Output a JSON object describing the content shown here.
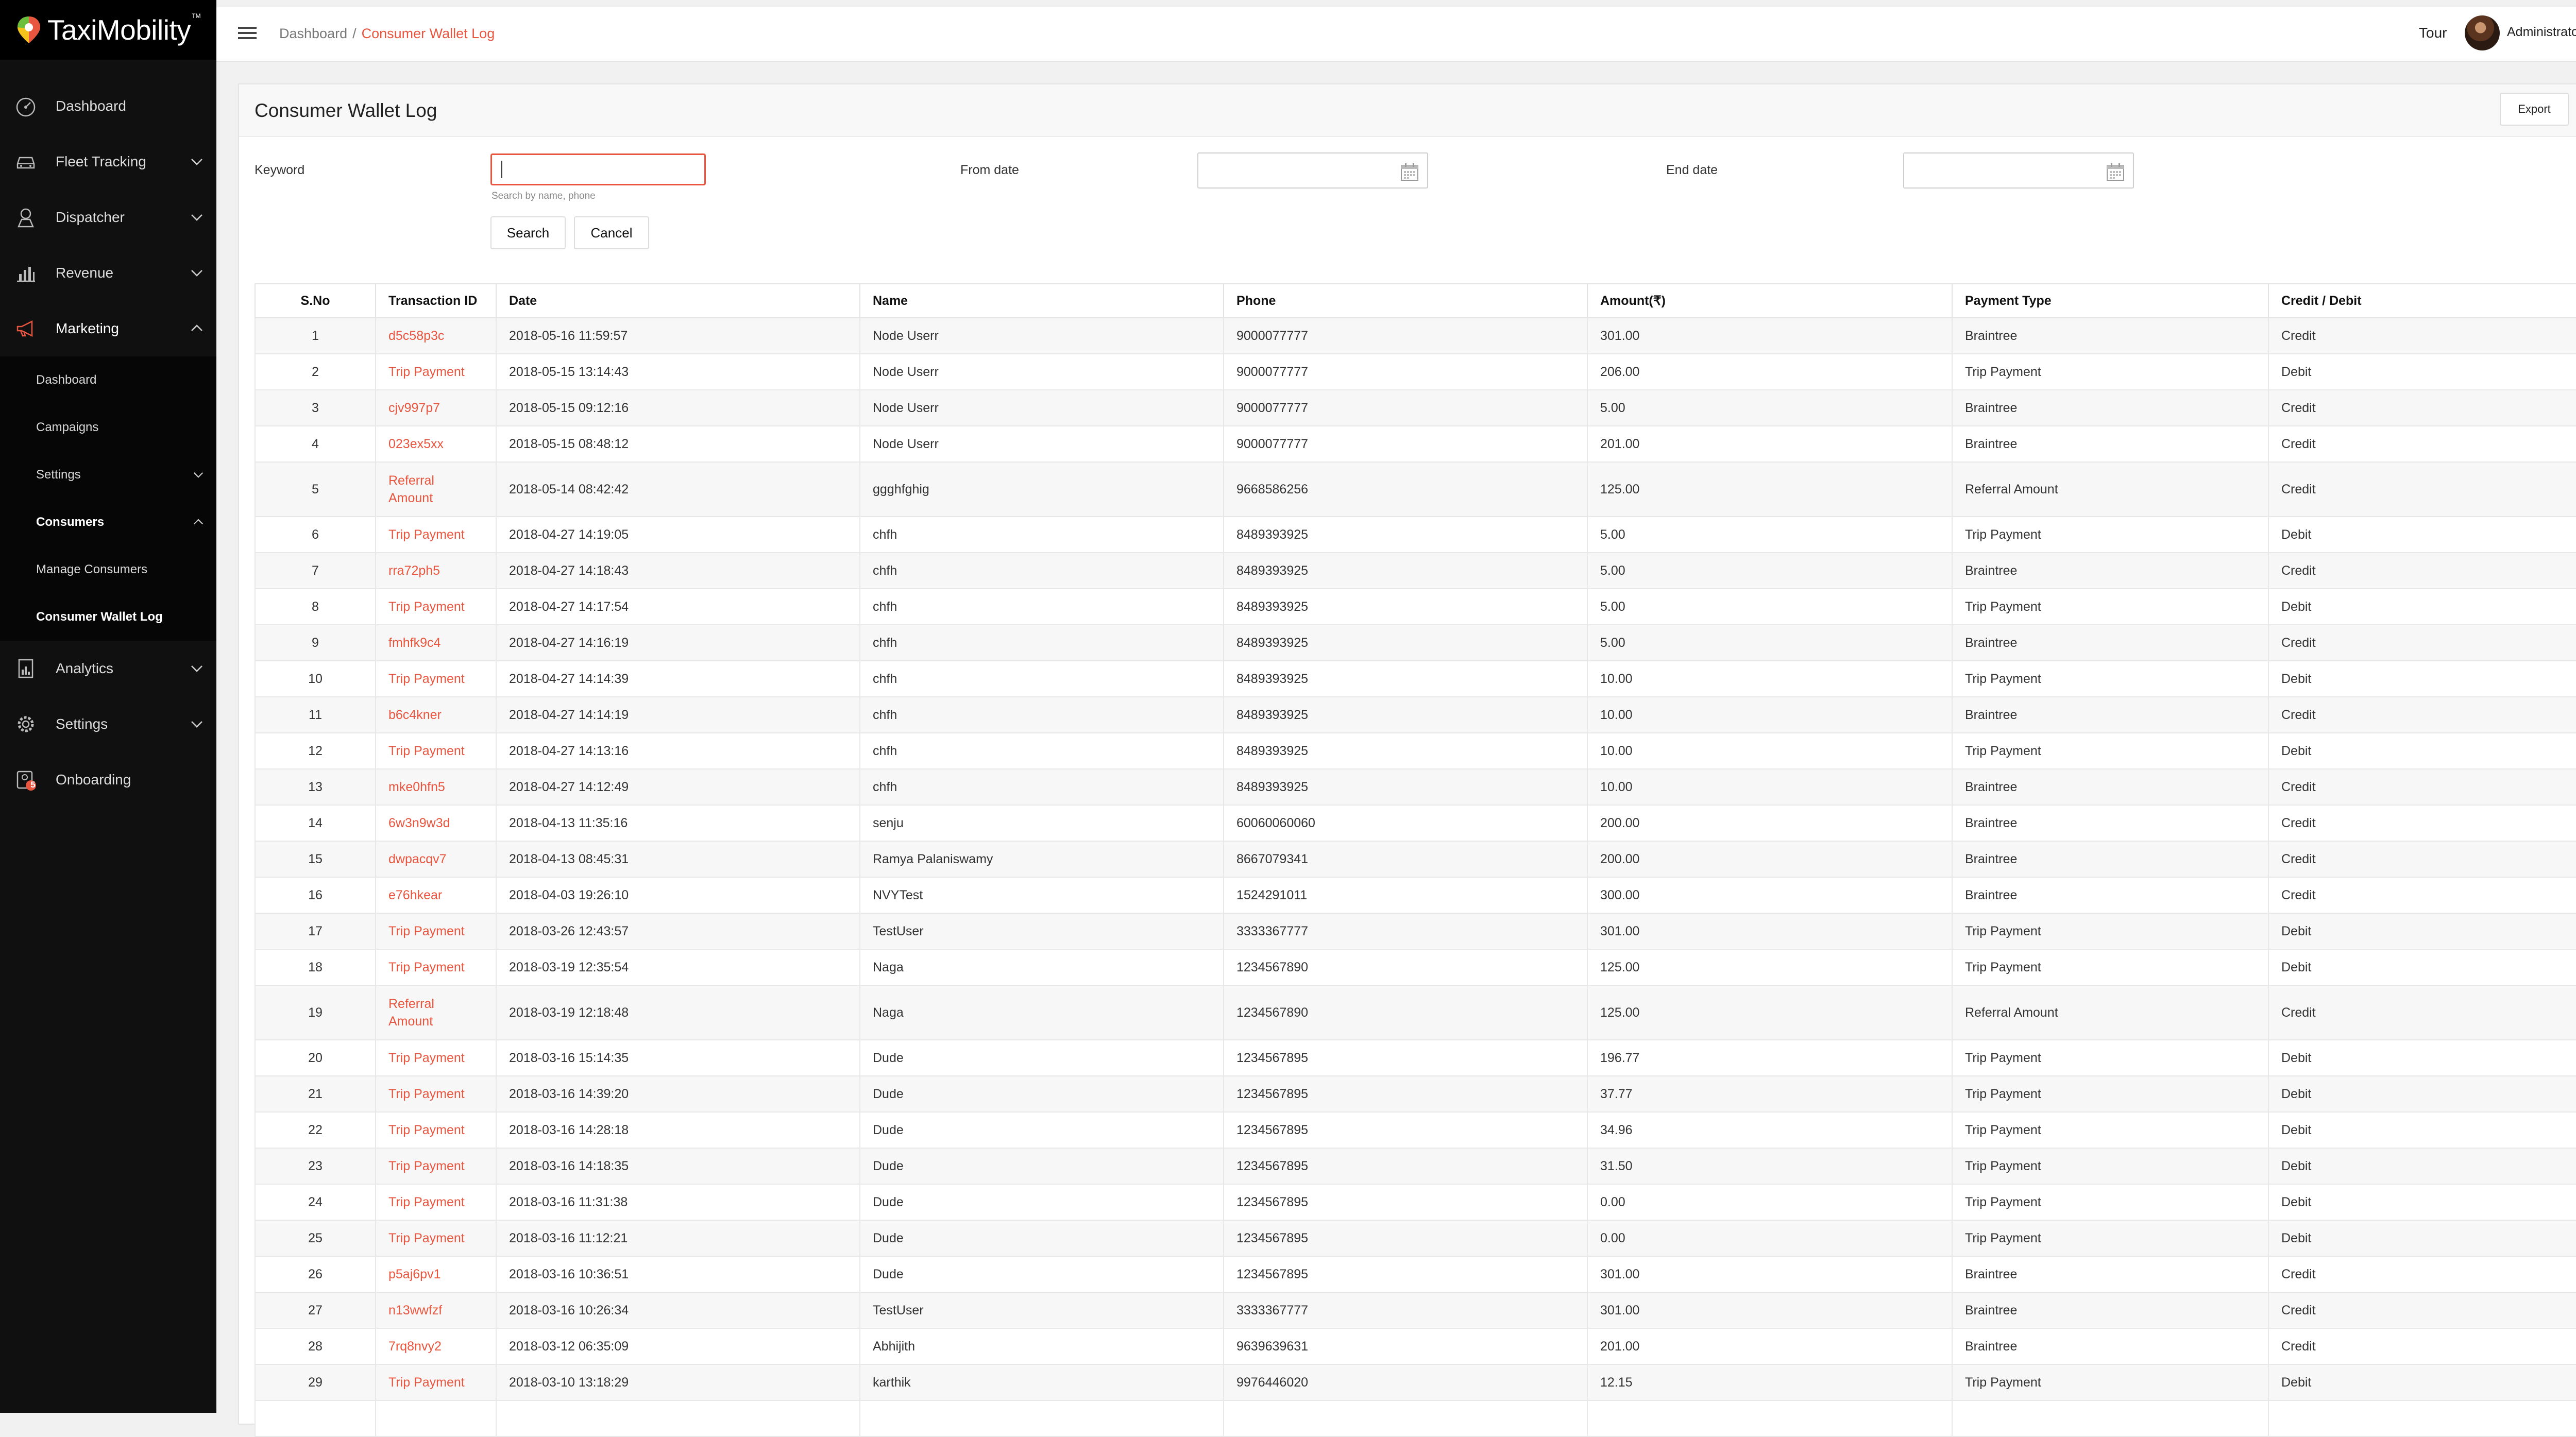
{
  "app": {
    "logo_text": "TaxiMobility",
    "logo_tm": "TM",
    "accent": "#e8563f"
  },
  "sidebar": {
    "items": [
      {
        "label": "Dashboard",
        "icon": "speedometer-icon",
        "has_chevron": false
      },
      {
        "label": "Fleet Tracking",
        "icon": "car-icon",
        "has_chevron": true
      },
      {
        "label": "Dispatcher",
        "icon": "dispatcher-pin-icon",
        "has_chevron": true
      },
      {
        "label": "Revenue",
        "icon": "bar-chart-icon",
        "has_chevron": true
      },
      {
        "label": "Marketing",
        "icon": "megaphone-icon",
        "has_chevron": true,
        "expanded": true
      }
    ],
    "marketing_sub": [
      {
        "label": "Dashboard"
      },
      {
        "label": "Campaigns"
      },
      {
        "label": "Settings",
        "has_chevron": true
      },
      {
        "label": "Consumers",
        "bold": true,
        "expanded": true
      },
      {
        "label": "Manage Consumers"
      },
      {
        "label": "Consumer Wallet Log",
        "active": true
      }
    ],
    "bottom_items": [
      {
        "label": "Analytics",
        "icon": "analytics-doc-icon",
        "has_chevron": true
      },
      {
        "label": "Settings",
        "icon": "gear-icon",
        "has_chevron": true
      },
      {
        "label": "Onboarding",
        "icon": "onboarding-icon",
        "badge": "5"
      }
    ]
  },
  "topbar": {
    "breadcrumb": {
      "root": "Dashboard",
      "separator": "/",
      "current": "Consumer Wallet Log"
    },
    "tour": "Tour",
    "user": "Administrator"
  },
  "page": {
    "title": "Consumer Wallet Log",
    "export_label": "Export",
    "filters": {
      "keyword_label": "Keyword",
      "keyword_value": "",
      "keyword_help": "Search by name, phone",
      "from_label": "From date",
      "end_label": "End date",
      "search_label": "Search",
      "cancel_label": "Cancel"
    }
  },
  "table": {
    "columns": [
      "S.No",
      "Transaction ID",
      "Date",
      "Name",
      "Phone",
      "Amount(₹)",
      "Payment Type",
      "Credit / Debit"
    ],
    "rows": [
      [
        "1",
        "d5c58p3c",
        "2018-05-16 11:59:57",
        "Node Userr",
        "9000077777",
        "301.00",
        "Braintree",
        "Credit"
      ],
      [
        "2",
        "Trip Payment",
        "2018-05-15 13:14:43",
        "Node Userr",
        "9000077777",
        "206.00",
        "Trip Payment",
        "Debit"
      ],
      [
        "3",
        "cjv997p7",
        "2018-05-15 09:12:16",
        "Node Userr",
        "9000077777",
        "5.00",
        "Braintree",
        "Credit"
      ],
      [
        "4",
        "023ex5xx",
        "2018-05-15 08:48:12",
        "Node Userr",
        "9000077777",
        "201.00",
        "Braintree",
        "Credit"
      ],
      [
        "5",
        "Referral Amount",
        "2018-05-14 08:42:42",
        "ggghfghig",
        "9668586256",
        "125.00",
        "Referral Amount",
        "Credit"
      ],
      [
        "6",
        "Trip Payment",
        "2018-04-27 14:19:05",
        "chfh",
        "8489393925",
        "5.00",
        "Trip Payment",
        "Debit"
      ],
      [
        "7",
        "rra72ph5",
        "2018-04-27 14:18:43",
        "chfh",
        "8489393925",
        "5.00",
        "Braintree",
        "Credit"
      ],
      [
        "8",
        "Trip Payment",
        "2018-04-27 14:17:54",
        "chfh",
        "8489393925",
        "5.00",
        "Trip Payment",
        "Debit"
      ],
      [
        "9",
        "fmhfk9c4",
        "2018-04-27 14:16:19",
        "chfh",
        "8489393925",
        "5.00",
        "Braintree",
        "Credit"
      ],
      [
        "10",
        "Trip Payment",
        "2018-04-27 14:14:39",
        "chfh",
        "8489393925",
        "10.00",
        "Trip Payment",
        "Debit"
      ],
      [
        "11",
        "b6c4kner",
        "2018-04-27 14:14:19",
        "chfh",
        "8489393925",
        "10.00",
        "Braintree",
        "Credit"
      ],
      [
        "12",
        "Trip Payment",
        "2018-04-27 14:13:16",
        "chfh",
        "8489393925",
        "10.00",
        "Trip Payment",
        "Debit"
      ],
      [
        "13",
        "mke0hfn5",
        "2018-04-27 14:12:49",
        "chfh",
        "8489393925",
        "10.00",
        "Braintree",
        "Credit"
      ],
      [
        "14",
        "6w3n9w3d",
        "2018-04-13 11:35:16",
        "senju",
        "60060060060",
        "200.00",
        "Braintree",
        "Credit"
      ],
      [
        "15",
        "dwpacqv7",
        "2018-04-13 08:45:31",
        "Ramya Palaniswamy",
        "8667079341",
        "200.00",
        "Braintree",
        "Credit"
      ],
      [
        "16",
        "e76hkear",
        "2018-04-03 19:26:10",
        "NVYTest",
        "1524291011",
        "300.00",
        "Braintree",
        "Credit"
      ],
      [
        "17",
        "Trip Payment",
        "2018-03-26 12:43:57",
        "TestUser",
        "3333367777",
        "301.00",
        "Trip Payment",
        "Debit"
      ],
      [
        "18",
        "Trip Payment",
        "2018-03-19 12:35:54",
        "Naga",
        "1234567890",
        "125.00",
        "Trip Payment",
        "Debit"
      ],
      [
        "19",
        "Referral Amount",
        "2018-03-19 12:18:48",
        "Naga",
        "1234567890",
        "125.00",
        "Referral Amount",
        "Credit"
      ],
      [
        "20",
        "Trip Payment",
        "2018-03-16 15:14:35",
        "Dude",
        "1234567895",
        "196.77",
        "Trip Payment",
        "Debit"
      ],
      [
        "21",
        "Trip Payment",
        "2018-03-16 14:39:20",
        "Dude",
        "1234567895",
        "37.77",
        "Trip Payment",
        "Debit"
      ],
      [
        "22",
        "Trip Payment",
        "2018-03-16 14:28:18",
        "Dude",
        "1234567895",
        "34.96",
        "Trip Payment",
        "Debit"
      ],
      [
        "23",
        "Trip Payment",
        "2018-03-16 14:18:35",
        "Dude",
        "1234567895",
        "31.50",
        "Trip Payment",
        "Debit"
      ],
      [
        "24",
        "Trip Payment",
        "2018-03-16 11:31:38",
        "Dude",
        "1234567895",
        "0.00",
        "Trip Payment",
        "Debit"
      ],
      [
        "25",
        "Trip Payment",
        "2018-03-16 11:12:21",
        "Dude",
        "1234567895",
        "0.00",
        "Trip Payment",
        "Debit"
      ],
      [
        "26",
        "p5aj6pv1",
        "2018-03-16 10:36:51",
        "Dude",
        "1234567895",
        "301.00",
        "Braintree",
        "Credit"
      ],
      [
        "27",
        "n13wwfzf",
        "2018-03-16 10:26:34",
        "TestUser",
        "3333367777",
        "301.00",
        "Braintree",
        "Credit"
      ],
      [
        "28",
        "7rq8nvy2",
        "2018-03-12 06:35:09",
        "Abhijith",
        "9639639631",
        "201.00",
        "Braintree",
        "Credit"
      ],
      [
        "29",
        "Trip Payment",
        "2018-03-10 13:18:29",
        "karthik",
        "9976446020",
        "12.15",
        "Trip Payment",
        "Debit"
      ],
      [
        "",
        "",
        "",
        "",
        "",
        "",
        "",
        ""
      ]
    ]
  }
}
